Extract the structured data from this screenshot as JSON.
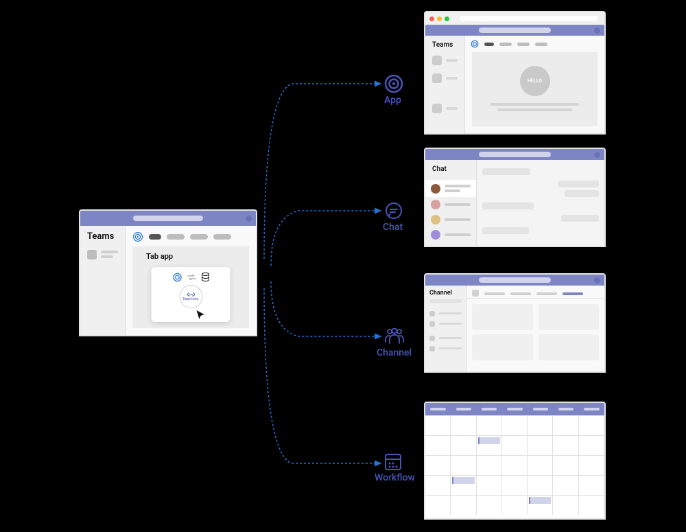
{
  "source": {
    "sidebar_title": "Teams",
    "content_label": "Tab app",
    "deeplink_label": "Deep links"
  },
  "destinations": {
    "app": {
      "label": "App",
      "sidebar_title": "Teams",
      "hello_text": "HELLO"
    },
    "chat": {
      "label": "Chat",
      "sidebar_title": "Chat"
    },
    "channel": {
      "label": "Channel",
      "sidebar_title": "Channel"
    },
    "workflow": {
      "label": "Workflow"
    }
  },
  "colors": {
    "brand": "#7e85c4",
    "accent": "#4a55b8",
    "arrow": "#2474d6"
  },
  "mac_traffic_lights": [
    "#ff5f57",
    "#febc2e",
    "#28c840"
  ]
}
